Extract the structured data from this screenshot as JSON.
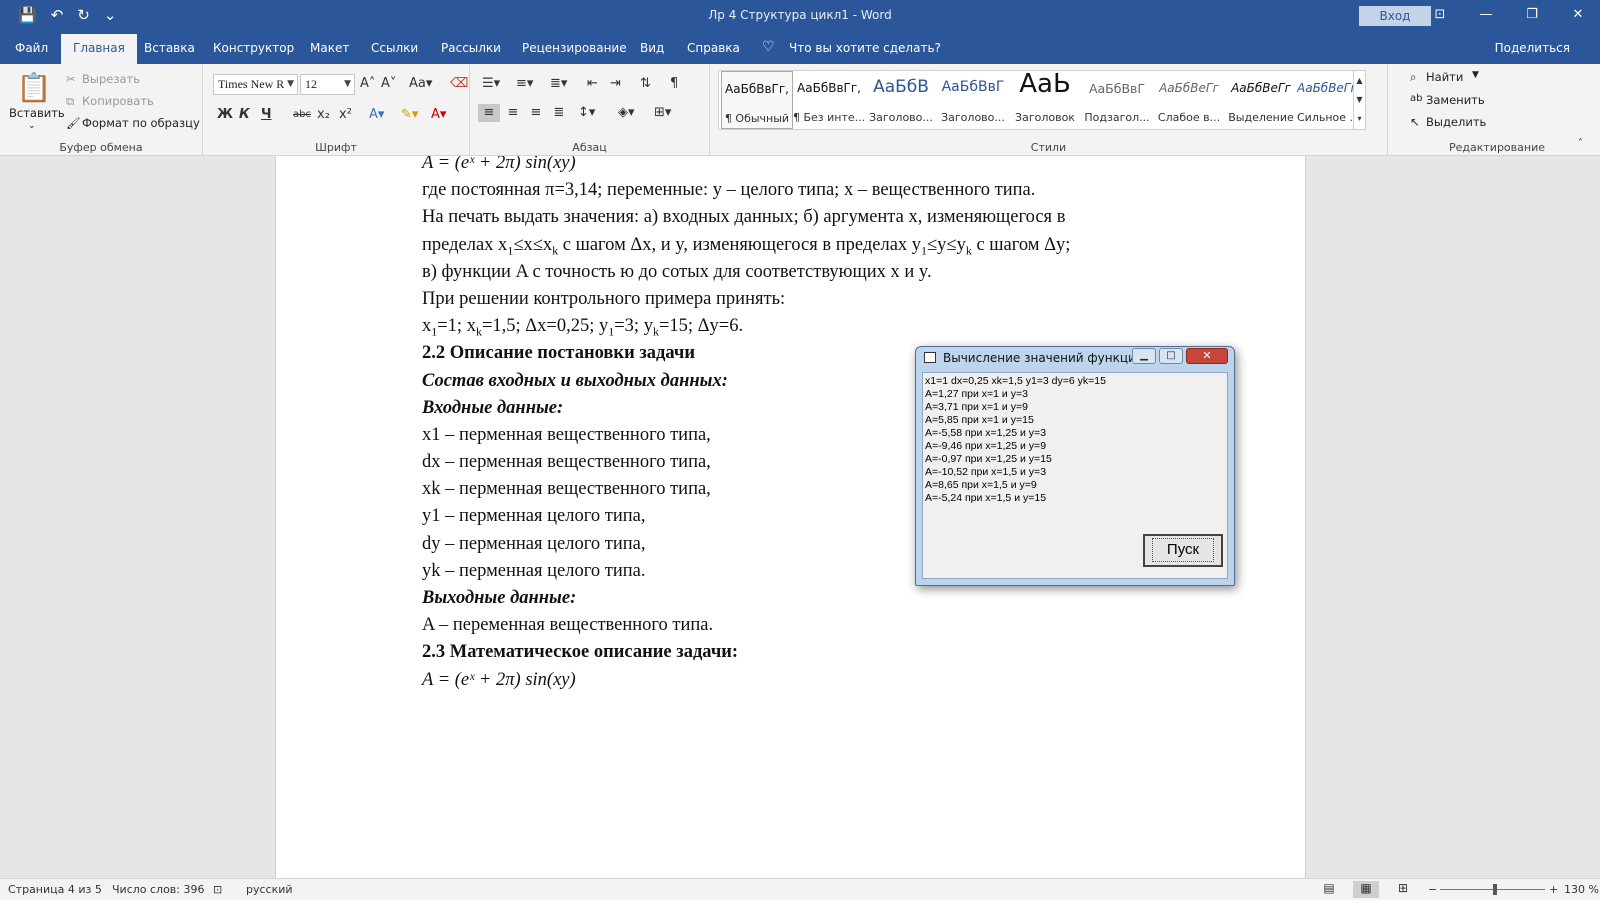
{
  "window": {
    "title": "Лр 4 Структура цикл1  -  Word",
    "signin": "Вход",
    "qat": [
      "💾",
      "↶",
      "↻",
      "⌄"
    ],
    "controls": [
      "⊡",
      "—",
      "❐",
      "✕"
    ]
  },
  "tabs": [
    "Файл",
    "Главная",
    "Вставка",
    "Конструктор",
    "Макет",
    "Ссылки",
    "Рассылки",
    "Рецензирование",
    "Вид",
    "Справка"
  ],
  "tell_me": "Что вы хотите сделать?",
  "share": "Поделиться",
  "ribbon": {
    "clipboard": {
      "paste": "Вставить",
      "cut": "Вырезать",
      "copy": "Копировать",
      "format_painter": "Формат по образцу",
      "label": "Буфер обмена"
    },
    "font": {
      "name": "Times New R",
      "size": "12",
      "label": "Шрифт",
      "buttons": [
        "Ж",
        "К",
        "Ч",
        "abc",
        "x₂",
        "x²"
      ]
    },
    "paragraph": {
      "label": "Абзац"
    },
    "styles": {
      "label": "Стили",
      "items": [
        {
          "preview": "АаБбВвГг,",
          "name": "¶ Обычный"
        },
        {
          "preview": "АаБбВвГг,",
          "name": "¶ Без инте..."
        },
        {
          "preview": "АаБбВ",
          "name": "Заголово..."
        },
        {
          "preview": "АаБбВвГ",
          "name": "Заголово..."
        },
        {
          "preview": "АаЬ",
          "name": "Заголовок"
        },
        {
          "preview": "АаБбВвГ",
          "name": "Подзагол..."
        },
        {
          "preview": "АаБбВеГг",
          "name": "Слабое в..."
        },
        {
          "preview": "АаБбВеГг",
          "name": "Выделение"
        },
        {
          "preview": "АаБбВеГг",
          "name": "Сильное ..."
        }
      ]
    },
    "editing": {
      "label": "Редактирование",
      "find": "Найти",
      "replace": "Заменить",
      "select": "Выделить"
    }
  },
  "document": {
    "formula": "A = (eˣ + 2π) sin(xy)",
    "line2": "где постоянная π=3,14; переменные: y – целого типа; x – вещественного типа.",
    "line3": "На печать выдать значения: а) входных данных; б) аргумента x, изменяющегося в",
    "line4_a": "пределах x",
    "line4_b": "≤x≤x",
    "line4_c": " с шагом Δx, и y, изменяющегося в пределах y",
    "line4_d": "≤y≤y",
    "line4_e": " с шагом Δy;",
    "line5": "в) функции A с точность     ю до сотых для соответствующих x и y.",
    "line6": "При решении контрольного примера принять:",
    "line7_a": "x",
    "line7_b": "=1; x",
    "line7_c": "=1,5; Δx=0,25; y",
    "line7_d": "=3; y",
    "line7_e": "=15; Δy=6.",
    "sub_1": "1",
    "sub_k": "k",
    "heading22": "2.2  Описание постановки задачи",
    "io_heading": "Состав входных и выходных данных:",
    "inputs_heading": "Входные данные:",
    "inputs": [
      "x1 – перменная вещественного типа,",
      "dx – перменная вещественного типа,",
      "xk – перменная вещественного типа,",
      "y1 – перменная целого типа,",
      "dy – перменная целого типа,",
      "yk – перменная целого типа."
    ],
    "outputs_heading": "Выходные данные:",
    "output": "A – переменная вещественного типа.",
    "heading23": "2.3 Математическое описание задачи:"
  },
  "dialog": {
    "title": "Вычисление значений функции",
    "lines": [
      "x1=1 dx=0,25 xk=1,5 y1=3 dy=6 yk=15",
      "A=1,27 при x=1 и y=3",
      "A=3,71 при x=1 и y=9",
      "A=5,85 при x=1 и y=15",
      "A=-5,58 при x=1,25 и y=3",
      "A=-9,46 при x=1,25 и y=9",
      "A=-0,97 при x=1,25 и y=15",
      "A=-10,52 при x=1,5 и y=3",
      "A=8,65 при x=1,5 и y=9",
      "A=-5,24 при x=1,5 и y=15"
    ],
    "button": "Пуск"
  },
  "status": {
    "page": "Страница 4 из 5",
    "words": "Число слов: 396",
    "language": "русский",
    "zoom": "130 %"
  },
  "colors": {
    "accent": "#2b579a",
    "dialog_frame": "#bcd4ec",
    "close": "#c8453a"
  }
}
